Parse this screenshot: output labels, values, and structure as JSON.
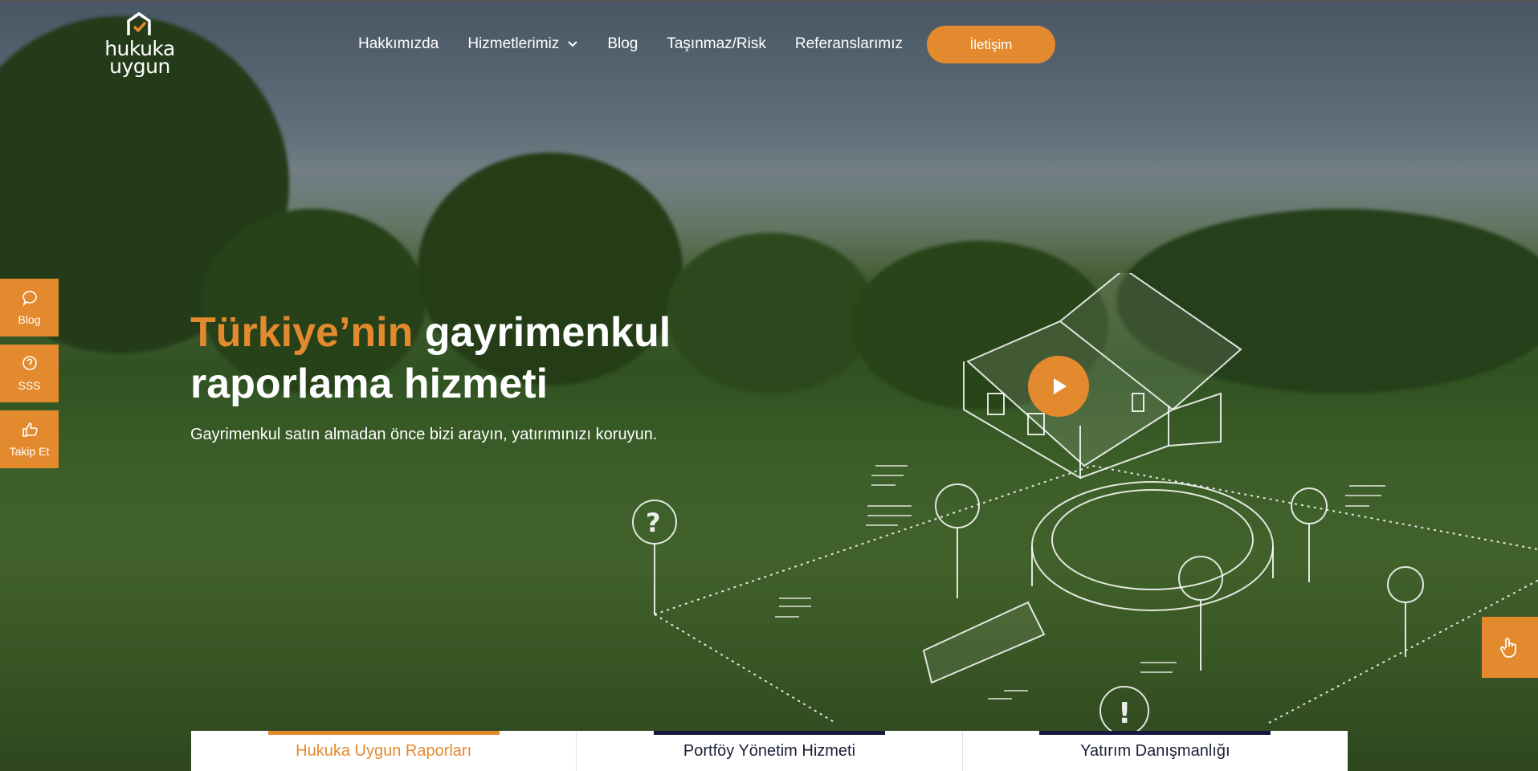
{
  "brand": {
    "line1": "hukuka",
    "line2": "uygun"
  },
  "nav": {
    "items": [
      "Hakkımızda",
      "Hizmetlerimiz",
      "Blog",
      "Taşınmaz/Risk",
      "Referanslarımız"
    ],
    "cta": "İletişim"
  },
  "side_buttons": [
    "Blog",
    "SSS",
    "Takip Et"
  ],
  "hero": {
    "title_accent": "Türkiye’nin",
    "title_rest": " gayrimenkul raporlama hizmeti",
    "subtitle": "Gayrimenkul satın almadan önce bizi arayın, yatırımınızı koruyun."
  },
  "tabs": [
    "Hukuka Uygun Raporları",
    "Portföy Yönetim Hizmeti",
    "Yatırım Danışmanlığı"
  ],
  "colors": {
    "accent": "#e48a2e",
    "navy": "#141a3d"
  },
  "icons": [
    "house-check-icon",
    "chevron-down-icon",
    "chat-icon",
    "question-icon",
    "thumbs-up-icon",
    "play-icon",
    "hand-pointer-icon"
  ]
}
